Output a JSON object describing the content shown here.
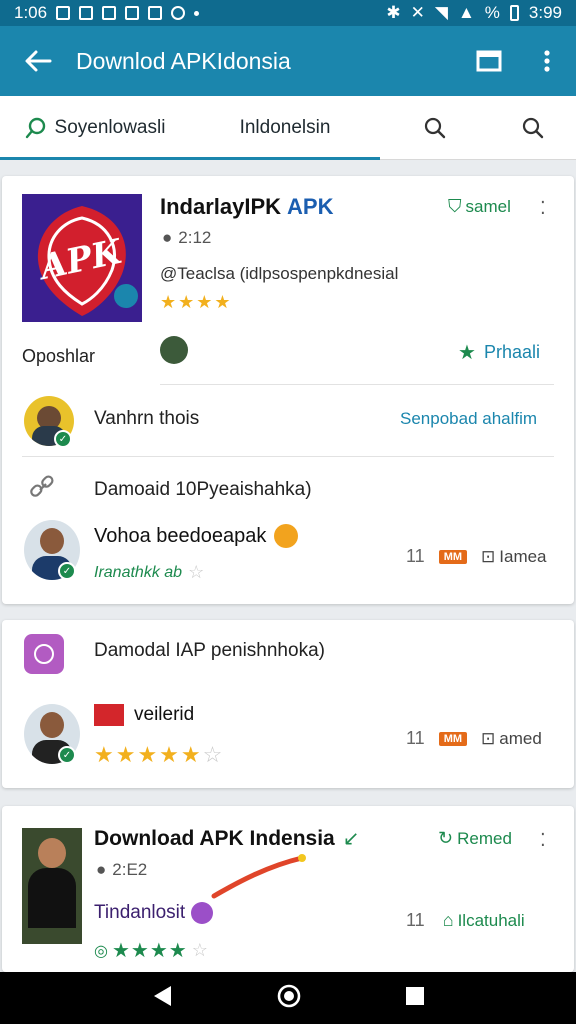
{
  "status": {
    "time": "1:06",
    "battery": "%",
    "right_time": "3:99"
  },
  "app_bar": {
    "title": "Downlod APKIdonsia"
  },
  "tabs": [
    {
      "label": "Soyenlowasli"
    },
    {
      "label": "Inldonelsin"
    }
  ],
  "card1": {
    "title": "IndarlayIPK",
    "title_accent": "APK",
    "time": "2:12",
    "handle": "@Teaclsa (idlpsospenpkdnesial",
    "saved_label": "samel",
    "author_label": "Oposhlar",
    "primary_label": "Prhaali",
    "logo_text": "APK",
    "logo_colors": {
      "bg": "#3a1f8f",
      "shape": "#d21f2d"
    },
    "row1": {
      "text": "Vanhrn thois",
      "link": "Senpobad ahalfim"
    },
    "row2": {
      "text": "Damoaid 10Pyeaishahka)"
    },
    "row3": {
      "name": "Vohoa beedoeapak",
      "rating_text": "Iranathkk ab",
      "count": "11",
      "badge": "MM",
      "extra": "Iamea"
    }
  },
  "card2": {
    "row1": {
      "text": "Damodal IAP penishnhoka)"
    },
    "row2": {
      "name": "veilerid",
      "count": "11",
      "badge": "MM",
      "extra": "amed"
    }
  },
  "card3": {
    "title": "Download APK Indensia",
    "time": "2:E2",
    "saved_label": "Remed",
    "name": "Tindanlosit",
    "count": "11",
    "extra": "Ilcatuhali"
  },
  "colors": {
    "primary": "#1b86ad",
    "status_bar": "#0f6b8f",
    "green": "#1d8a4e",
    "orange": "#e46b19",
    "star": "#f2b01e"
  }
}
